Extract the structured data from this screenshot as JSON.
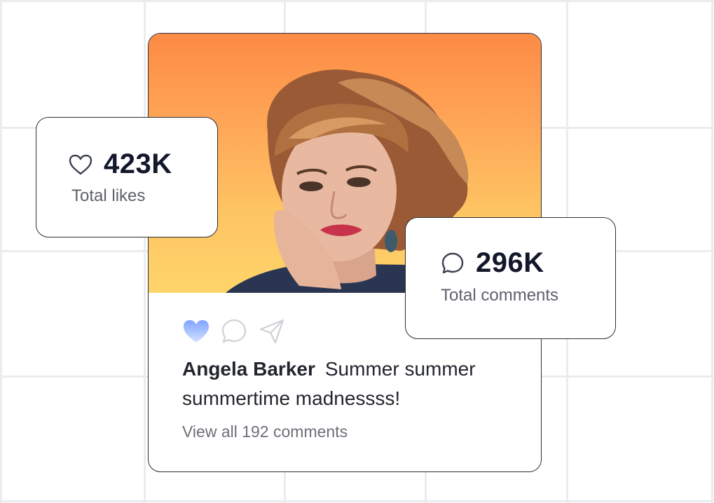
{
  "post": {
    "author": "Angela Barker",
    "caption": "Summer summer summertime madnessss!",
    "view_comments": "View all 192 comments",
    "photo_icon": "portrait-photo",
    "actions": [
      "heart-icon",
      "comment-icon",
      "send-icon"
    ]
  },
  "stats": {
    "likes": {
      "value": "423K",
      "label": "Total likes",
      "icon": "heart-outline-icon"
    },
    "comments": {
      "value": "296K",
      "label": "Total comments",
      "icon": "comment-outline-icon"
    }
  },
  "colors": {
    "photo_gradient_top": "#fd8b45",
    "photo_gradient_bottom": "#fed46a",
    "like_active": "#8fb0ff",
    "border": "#2c2f36",
    "grid": "#ececef"
  }
}
